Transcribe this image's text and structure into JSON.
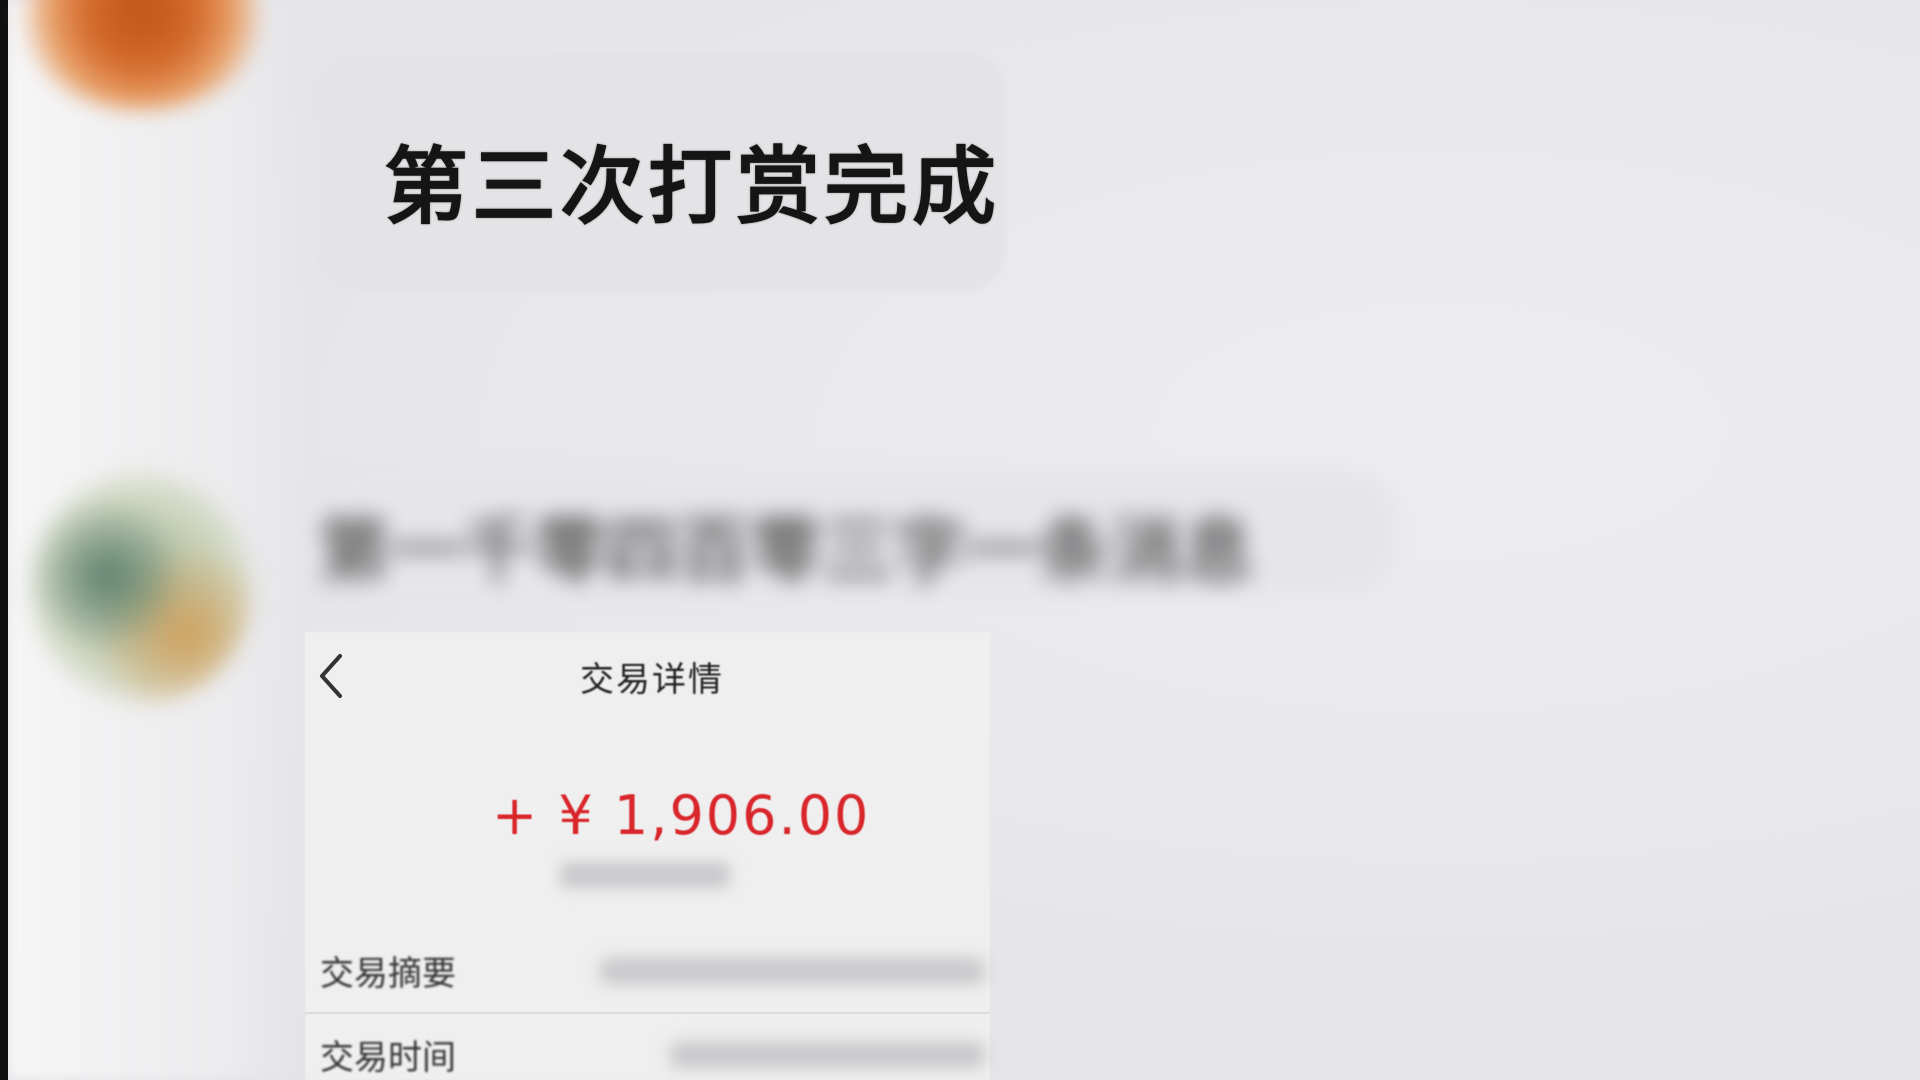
{
  "chat": {
    "messages": [
      {
        "text": "第三次打赏完成"
      },
      {
        "text": "第一千零四百零三字一条消息"
      }
    ]
  },
  "transaction": {
    "header_title": "交易详情",
    "amount": "+ ¥ 1,906.00",
    "rows": [
      {
        "label": "交易摘要"
      },
      {
        "label": "交易时间"
      }
    ]
  },
  "colors": {
    "amount": "#d9262b",
    "background": "#e9e9ec"
  },
  "icons": {
    "back": "chevron-left-icon"
  }
}
